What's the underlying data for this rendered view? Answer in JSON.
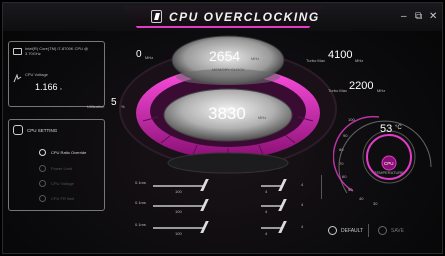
{
  "title": "CPU OVERCLOCKING",
  "window": {
    "minimize": "–",
    "restore": "⧉",
    "close": "✕"
  },
  "cpu_info": {
    "name": "Intel(R) Core(TM) i7-8700K CPU @ 3.70GHz",
    "voltage_label": "CPU Voltage",
    "voltage_value": "1.166",
    "voltage_unit": "v"
  },
  "cpu_setting": {
    "header": "CPU SETTING",
    "items": [
      {
        "label": "CPU Ratio Override",
        "active": true
      },
      {
        "label": "Power Limit",
        "active": false
      },
      {
        "label": "CPU Voltage",
        "active": false
      },
      {
        "label": "CPU FR limit",
        "active": false
      }
    ]
  },
  "gauge": {
    "left_top_value": "0",
    "left_top_unit": "MHz",
    "top_value": "2654",
    "top_unit": "MHz",
    "top_caption": "MEMORY CLOCK",
    "turbo1_label": "Turbo Max",
    "turbo1_value": "4100",
    "turbo1_unit": "MHz",
    "turbo2_label": "Turbo Max",
    "turbo2_value": "2200",
    "turbo2_unit": "MHz",
    "util_label": "Utilization",
    "util_value": "5",
    "util_unit": "%",
    "main_value": "3830",
    "main_unit": "MHz"
  },
  "temperature": {
    "value": "53",
    "unit": "°C",
    "chip": "CPU",
    "caption": "TEMPERATURE",
    "ticks": [
      "100",
      "90",
      "80",
      "70",
      "60",
      "50",
      "40",
      "30"
    ]
  },
  "sliders": [
    {
      "label": "0.1ms",
      "mid": "100",
      "right": "4"
    },
    {
      "label": "0.1ms",
      "mid": "100",
      "right": "4"
    },
    {
      "label": "0.1ms",
      "mid": "100",
      "right": "4"
    }
  ],
  "buttons": {
    "default": "DEFAULT",
    "save": "SAVE"
  },
  "colors": {
    "accent": "#e23cc7",
    "background": "#0b0b0d"
  }
}
